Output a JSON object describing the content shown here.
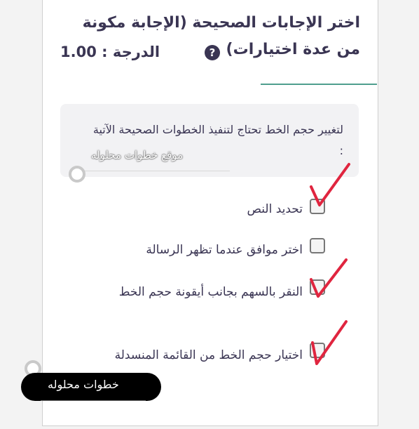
{
  "question": {
    "title": "اختر الإجابات الصحيحة (الإجابة مكونة من عدة اختيارات)",
    "grade_label": "الدرجة : 1.00",
    "help_icon": "question-circle-icon",
    "help_glyph": "?"
  },
  "prompt": {
    "text": "لتغيير حجم الخط تحتاج لتنفيذ الخطوات الصحيحة الآتية :"
  },
  "watermark": {
    "text": "موقع خطوات محلوله"
  },
  "options": [
    {
      "label": "تحديد النص",
      "checked": false,
      "hand_checkmark": true
    },
    {
      "label": "اختر موافق عندما تظهر الرسالة",
      "checked": false,
      "hand_checkmark": false
    },
    {
      "label": "النقر بالسهم بجانب أيقونة حجم الخط",
      "checked": false,
      "hand_checkmark": true
    },
    {
      "label": "اختيار حجم الخط من القائمة المنسدلة",
      "checked": false,
      "hand_checkmark": true
    }
  ],
  "badge": {
    "text": "خطوات محلوله"
  },
  "colors": {
    "text": "#3a3553",
    "accent": "#4f9e8e",
    "checkmark": "#e0253f"
  }
}
